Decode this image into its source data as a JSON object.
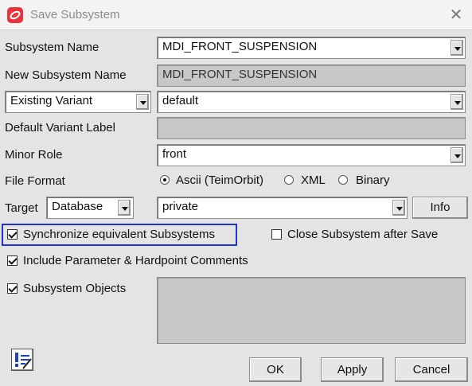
{
  "window": {
    "title": "Save Subsystem",
    "close_label": "✕"
  },
  "form": {
    "subsystem_name": {
      "label": "Subsystem Name",
      "value": "MDI_FRONT_SUSPENSION"
    },
    "new_subsystem_name": {
      "label": "New Subsystem Name",
      "value": "MDI_FRONT_SUSPENSION"
    },
    "variant": {
      "selector_value": "Existing Variant",
      "value": "default"
    },
    "default_variant_label": {
      "label": "Default Variant Label",
      "value": ""
    },
    "minor_role": {
      "label": "Minor Role",
      "value": "front"
    },
    "file_format": {
      "label": "File Format",
      "options": [
        "Ascii (TeimOrbit)",
        "XML",
        "Binary"
      ],
      "selected": "Ascii (TeimOrbit)"
    },
    "target": {
      "label": "Target",
      "type_value": "Database",
      "value": "private",
      "info_label": "Info"
    },
    "sync_equivalent": {
      "label": "Synchronize equivalent Subsystems",
      "checked": true
    },
    "close_after_save": {
      "label": "Close Subsystem after Save",
      "checked": false
    },
    "include_comments": {
      "label": "Include Parameter & Hardpoint Comments",
      "checked": true
    },
    "subsystem_objects": {
      "label": "Subsystem Objects",
      "checked": true
    }
  },
  "buttons": {
    "ok": "OK",
    "apply": "Apply",
    "cancel": "Cancel"
  },
  "icons": {
    "app": "adams-car-icon",
    "notes": "notes-pencil-icon"
  },
  "colors": {
    "highlight": "#1f32d6",
    "app_icon": "#e8343a"
  }
}
